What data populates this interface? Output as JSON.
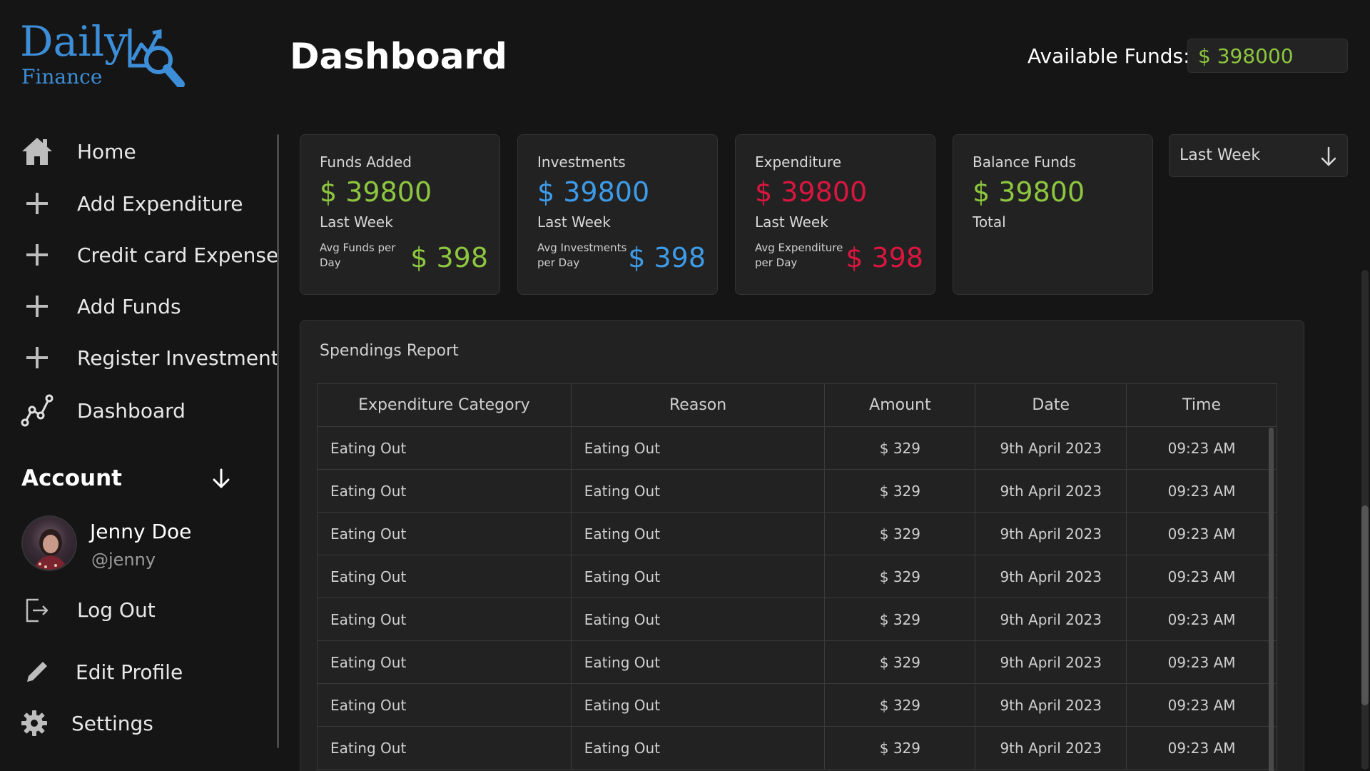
{
  "app": {
    "logo_top": "Daily",
    "logo_bottom": "Finance"
  },
  "header": {
    "title": "Dashboard",
    "funds_label": "Available Funds:",
    "funds_value": "$ 398000"
  },
  "sidebar": {
    "items": [
      {
        "label": "Home",
        "icon": "home-icon"
      },
      {
        "label": "Add Expenditure",
        "icon": "plus-icon"
      },
      {
        "label": "Credit card Expense",
        "icon": "plus-icon"
      },
      {
        "label": "Add Funds",
        "icon": "plus-icon"
      },
      {
        "label": "Register Investment",
        "icon": "plus-icon"
      },
      {
        "label": "Dashboard",
        "icon": "chart-line-icon"
      }
    ],
    "account": {
      "title": "Account",
      "user_name": "Jenny Doe",
      "user_handle": "@jenny"
    },
    "bottom_items": [
      {
        "label": "Log Out",
        "icon": "logout-icon"
      },
      {
        "label": "Edit Profile",
        "icon": "pencil-icon"
      },
      {
        "label": "Settings",
        "icon": "gear-icon"
      }
    ]
  },
  "cards": [
    {
      "title": "Funds Added",
      "value": "$ 39800",
      "period": "Last Week",
      "avg_label": "Avg Funds per Day",
      "avg_value": "$ 398",
      "color": "#8dc63f"
    },
    {
      "title": "Investments",
      "value": "$ 39800",
      "period": "Last Week",
      "avg_label": "Avg Investments per Day",
      "avg_value": "$ 398",
      "color": "#3d9be8"
    },
    {
      "title": "Expenditure",
      "value": "$ 39800",
      "period": "Last Week",
      "avg_label": "Avg Expenditure per Day",
      "avg_value": "$ 398",
      "color": "#d9163f"
    },
    {
      "title": "Balance Funds",
      "value": "$ 39800",
      "period": "Total",
      "color": "#8dc63f"
    }
  ],
  "period_select": {
    "value": "Last Week"
  },
  "report": {
    "title": "Spendings Report",
    "columns": [
      "Expenditure Category",
      "Reason",
      "Amount",
      "Date",
      "Time"
    ],
    "rows": [
      [
        "Eating Out",
        "Eating Out",
        "$ 329",
        "9th April 2023",
        "09:23 AM"
      ],
      [
        "Eating Out",
        "Eating Out",
        "$ 329",
        "9th April 2023",
        "09:23 AM"
      ],
      [
        "Eating Out",
        "Eating Out",
        "$ 329",
        "9th April 2023",
        "09:23 AM"
      ],
      [
        "Eating Out",
        "Eating Out",
        "$ 329",
        "9th April 2023",
        "09:23 AM"
      ],
      [
        "Eating Out",
        "Eating Out",
        "$ 329",
        "9th April 2023",
        "09:23 AM"
      ],
      [
        "Eating Out",
        "Eating Out",
        "$ 329",
        "9th April 2023",
        "09:23 AM"
      ],
      [
        "Eating Out",
        "Eating Out",
        "$ 329",
        "9th April 2023",
        "09:23 AM"
      ],
      [
        "Eating Out",
        "Eating Out",
        "$ 329",
        "9th April 2023",
        "09:23 AM"
      ]
    ]
  },
  "colors": {
    "accent_blue": "#3d8ed8",
    "positive": "#8dc63f",
    "negative": "#d9163f",
    "background": "#151515",
    "panel": "#222222"
  }
}
